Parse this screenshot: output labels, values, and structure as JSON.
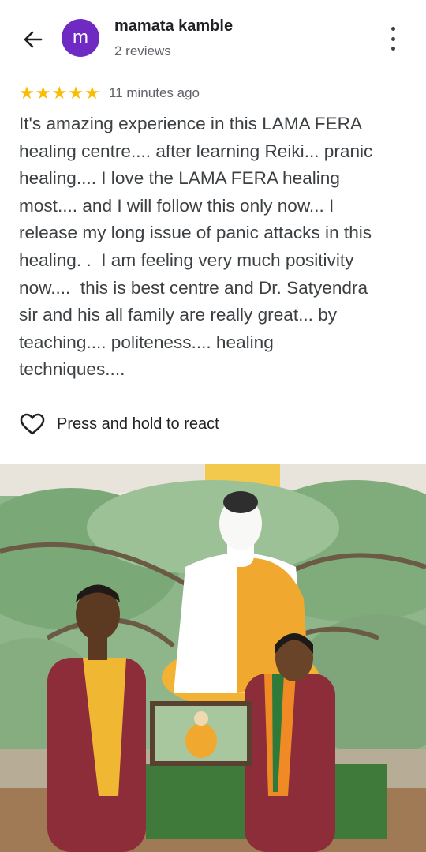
{
  "header": {
    "avatar_letter": "m",
    "avatar_color": "#6f2ac3",
    "user_name": "mamata kamble",
    "review_count": "2 reviews"
  },
  "review": {
    "rating": 5,
    "time": "11 minutes ago",
    "text": "It's amazing experience in this LAMA FERA\nhealing centre.... after learning Reiki... pranic\nhealing.... I love the LAMA FERA healing\nmost.... and I will follow this only now... I\nrelease my long issue of panic attacks in this\nhealing. .  I am feeling very much positivity\nnow....  this is best centre and Dr. Satyendra\nsir and his all family are really great... by\nteaching.... politeness.... healing\ntechniques...."
  },
  "reaction": {
    "label": "Press and hold to react"
  },
  "colors": {
    "star": "#fbbc04",
    "text": "#3c4043",
    "secondary": "#5f6368"
  }
}
